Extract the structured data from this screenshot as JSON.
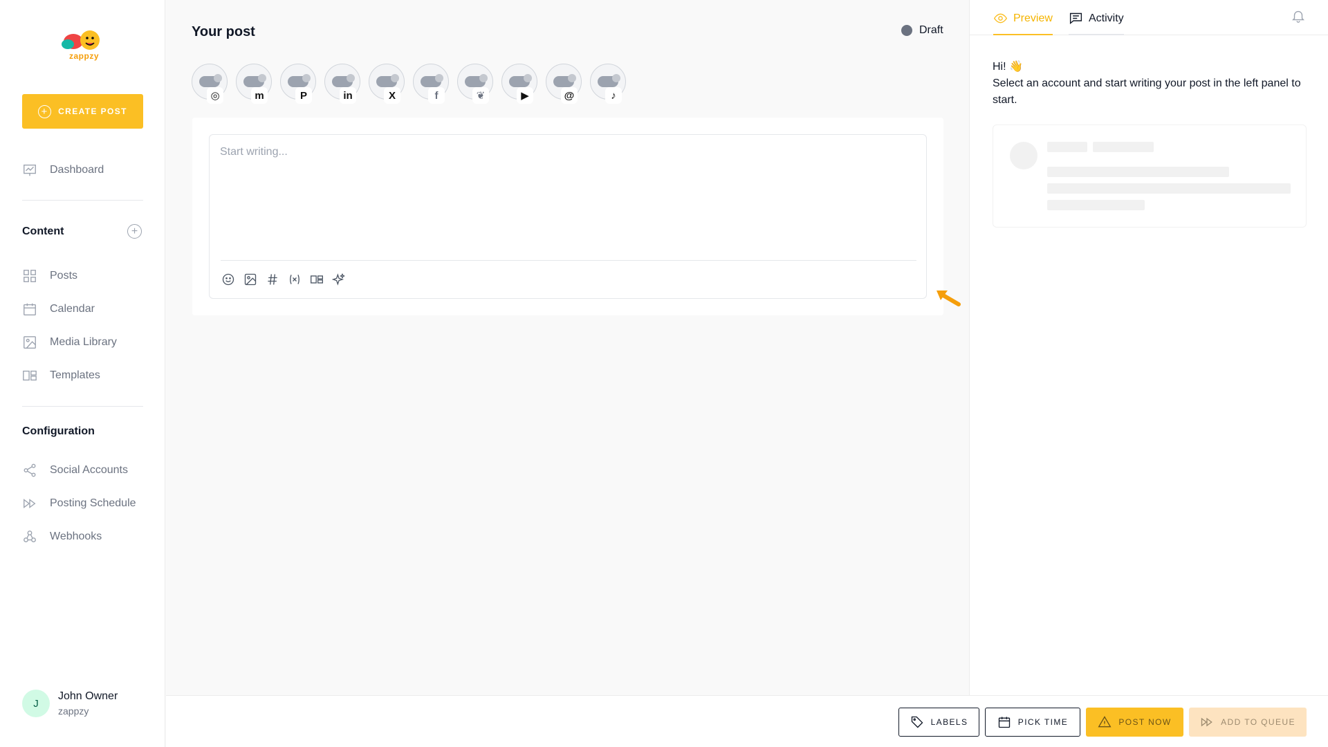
{
  "sidebar": {
    "logo_text": "zappzy",
    "create_post_label": "CREATE POST",
    "nav_dashboard": "Dashboard",
    "content_title": "Content",
    "content_items": [
      "Posts",
      "Calendar",
      "Media Library",
      "Templates"
    ],
    "configuration_title": "Configuration",
    "configuration_items": [
      "Social Accounts",
      "Posting Schedule",
      "Webhooks"
    ],
    "user": {
      "initial": "J",
      "name": "John Owner",
      "org": "zappzy"
    }
  },
  "main": {
    "title": "Your post",
    "status": "Draft",
    "accounts": [
      {
        "network": "instagram",
        "icon": "instagram-icon",
        "glyph": "◎"
      },
      {
        "network": "mastodon",
        "icon": "mastodon-icon",
        "glyph": "m"
      },
      {
        "network": "pinterest",
        "icon": "pinterest-icon",
        "glyph": "P"
      },
      {
        "network": "linkedin",
        "icon": "linkedin-icon",
        "glyph": "in"
      },
      {
        "network": "x",
        "icon": "x-icon",
        "glyph": "X"
      },
      {
        "network": "facebook",
        "icon": "facebook-icon",
        "glyph": "f"
      },
      {
        "network": "bluesky",
        "icon": "bluesky-icon",
        "glyph": "❦"
      },
      {
        "network": "youtube",
        "icon": "youtube-icon",
        "glyph": "▶"
      },
      {
        "network": "threads",
        "icon": "threads-icon",
        "glyph": "@"
      },
      {
        "network": "tiktok",
        "icon": "tiktok-icon",
        "glyph": "♪"
      }
    ],
    "editor_placeholder": "Start writing...",
    "toolbar": [
      "emoji-icon",
      "image-icon",
      "hashtag-icon",
      "variable-icon",
      "template-icon",
      "ai-sparkles-icon"
    ]
  },
  "actions": {
    "labels": "LABELS",
    "pick_time": "PICK TIME",
    "post_now": "POST NOW",
    "add_to_queue": "ADD TO QUEUE"
  },
  "preview": {
    "tab_preview": "Preview",
    "tab_activity": "Activity",
    "greeting": "Hi! 👋",
    "message": "Select an account and start writing your post in the left panel to start."
  },
  "colors": {
    "accent": "#fbbf24",
    "accent_light": "#fde3c0",
    "status_draft": "#6b7280",
    "arrow": "#f59e0b"
  }
}
